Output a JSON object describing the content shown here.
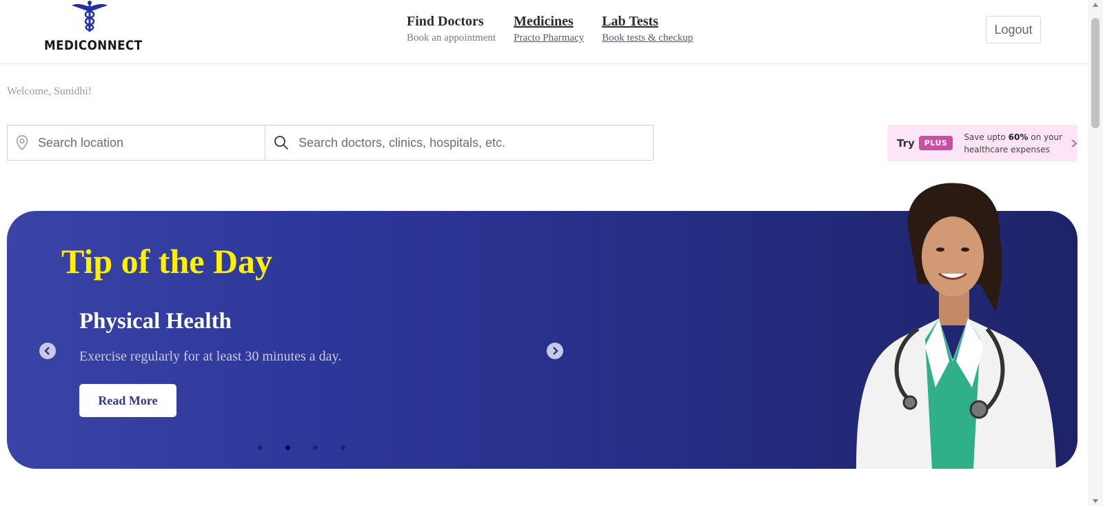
{
  "brand": {
    "name": "MEDICONNECT"
  },
  "nav": {
    "items": [
      {
        "title": "Find Doctors",
        "sub": "Book an appointment"
      },
      {
        "title": "Medicines",
        "sub": "Practo Pharmacy"
      },
      {
        "title": "Lab Tests",
        "sub": "Book tests & checkup"
      }
    ]
  },
  "header": {
    "logout_label": "Logout"
  },
  "welcome": "Welcome, Sunidhi!",
  "search": {
    "location_placeholder": "Search location",
    "query_placeholder": "Search doctors, clinics, hospitals, etc."
  },
  "plus": {
    "try": "Try",
    "badge": "PLUS",
    "text_pre": "Save upto ",
    "text_bold": "60%",
    "text_post": " on your healthcare expenses"
  },
  "banner": {
    "heading": "Tip of the Day",
    "slide_title": "Physical Health",
    "slide_text": "Exercise regularly for at least 30 minutes a day.",
    "read_more": "Read More",
    "slide_count": 4,
    "active_slide": 1
  },
  "colors": {
    "accent_yellow": "#fff200",
    "banner_blue": "#2d3799",
    "plus_pink": "#c84fa1",
    "plus_bg": "#fde5f5"
  },
  "icons": [
    "caduceus-icon",
    "location-pin-icon",
    "search-icon",
    "chevron-right-icon",
    "prev-arrow-icon",
    "next-arrow-icon"
  ]
}
